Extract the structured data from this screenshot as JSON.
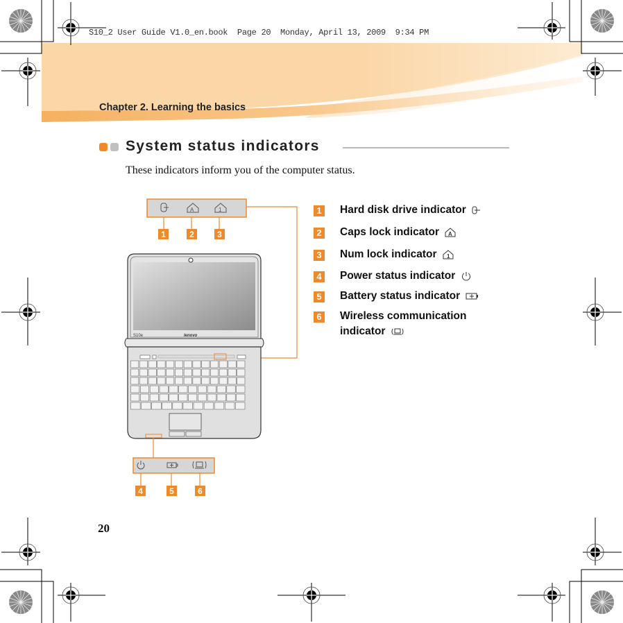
{
  "print_slug": "S10_2 User Guide V1.0_en.book  Page 20  Monday, April 13, 2009  9:34 PM",
  "header": {
    "chapter_title": "Chapter 2. Learning the basics"
  },
  "section": {
    "title": "System status indicators",
    "intro": "These indicators inform you of the computer status."
  },
  "indicators": [
    {
      "number": "1",
      "label": "Hard disk drive indicator",
      "icon": "hdd-icon"
    },
    {
      "number": "2",
      "label": "Caps lock indicator",
      "icon": "caps-lock-icon"
    },
    {
      "number": "3",
      "label": "Num lock indicator",
      "icon": "num-lock-icon"
    },
    {
      "number": "4",
      "label": "Power status indicator",
      "icon": "power-icon"
    },
    {
      "number": "5",
      "label": "Battery status indicator",
      "icon": "battery-icon"
    },
    {
      "number": "6",
      "label_line1": "Wireless communication",
      "label_line2": "indicator",
      "icon": "wireless-icon"
    }
  ],
  "laptop": {
    "model_label": "S10e",
    "brand_label": "lenovo"
  },
  "footer": {
    "page_number": "20"
  },
  "colors": {
    "accent": "#f0892a",
    "banner": "#fbd7a8",
    "bullet_gray": "#c0c0c0",
    "panel_gray": "#d6d6d6"
  }
}
